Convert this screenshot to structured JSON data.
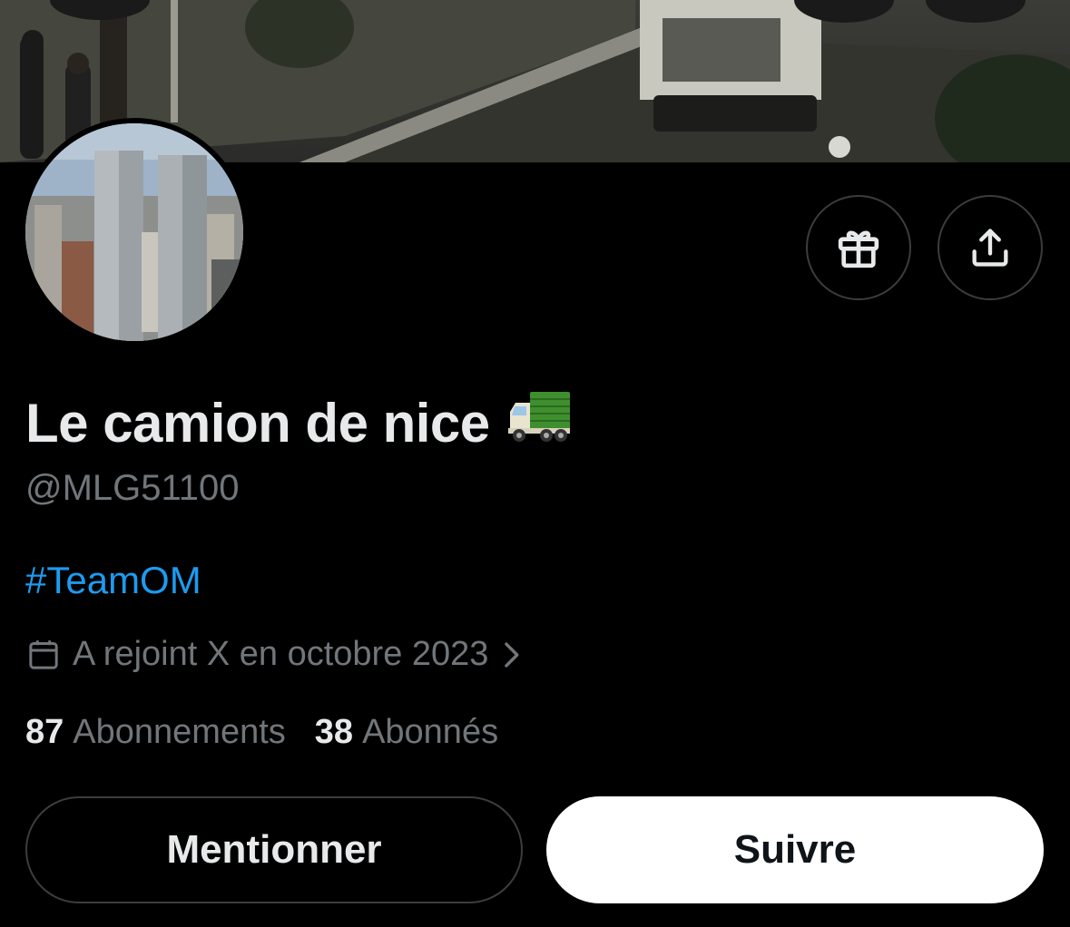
{
  "profile": {
    "display_name": "Le camion de nice",
    "name_emoji": "delivery-truck",
    "handle": "@MLG51100",
    "bio": "#TeamOM",
    "joined": "A rejoint X en octobre 2023",
    "following_count": "87",
    "following_label": "Abonnements",
    "followers_count": "38",
    "followers_label": "Abonnés"
  },
  "actions": {
    "mention_label": "Mentionner",
    "follow_label": "Suivre",
    "gift_icon": "gift-icon",
    "share_icon": "share-icon"
  },
  "colors": {
    "background": "#000000",
    "primary_text": "#e7e9ea",
    "secondary_text": "#71767b",
    "link": "#1d9bf0",
    "border": "#3a3d40"
  }
}
